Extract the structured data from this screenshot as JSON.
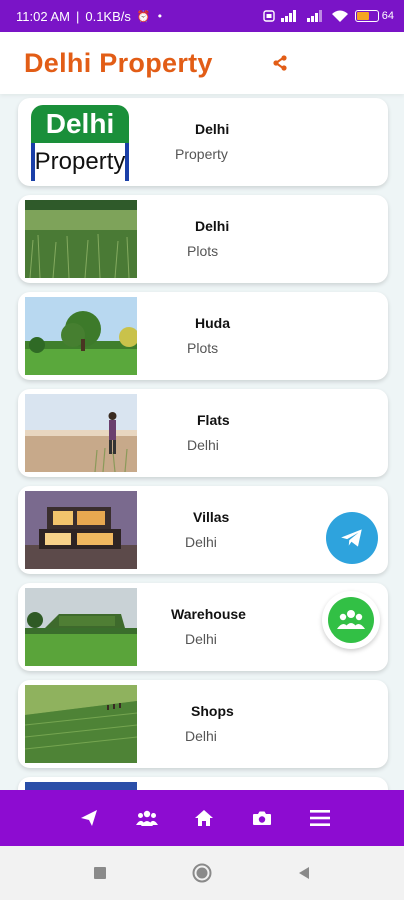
{
  "status_bar": {
    "time": "11:02 AM",
    "speed": "0.1KB/s",
    "battery": "64",
    "battery_level": 0.64
  },
  "app_bar": {
    "title": "Delhi Property",
    "share_icon": "share-icon"
  },
  "colors": {
    "title": "#e25d16",
    "status_bar": "#7a14c7",
    "bottom_nav": "#8d0cd1",
    "list_bg": "#eef5f6",
    "telegram": "#2ea3dd",
    "group": "#32c045"
  },
  "cards": [
    {
      "title": "Delhi",
      "subtitle": "Property",
      "logo_top": "Delhi",
      "logo_bottom": "Property"
    },
    {
      "title": "Delhi",
      "subtitle": "Plots"
    },
    {
      "title": "Huda",
      "subtitle": "Plots"
    },
    {
      "title": "Flats",
      "subtitle": "Delhi"
    },
    {
      "title": "Villas",
      "subtitle": "Delhi"
    },
    {
      "title": "Warehouse",
      "subtitle": "Delhi"
    },
    {
      "title": "Shops",
      "subtitle": "Delhi"
    }
  ],
  "fabs": [
    "telegram-icon",
    "group-chat-icon"
  ],
  "bottom_nav": [
    "send-icon",
    "group-icon",
    "home-icon",
    "camera-icon",
    "menu-icon"
  ],
  "system_nav": [
    "recents-icon",
    "home-circle-icon",
    "back-icon"
  ]
}
